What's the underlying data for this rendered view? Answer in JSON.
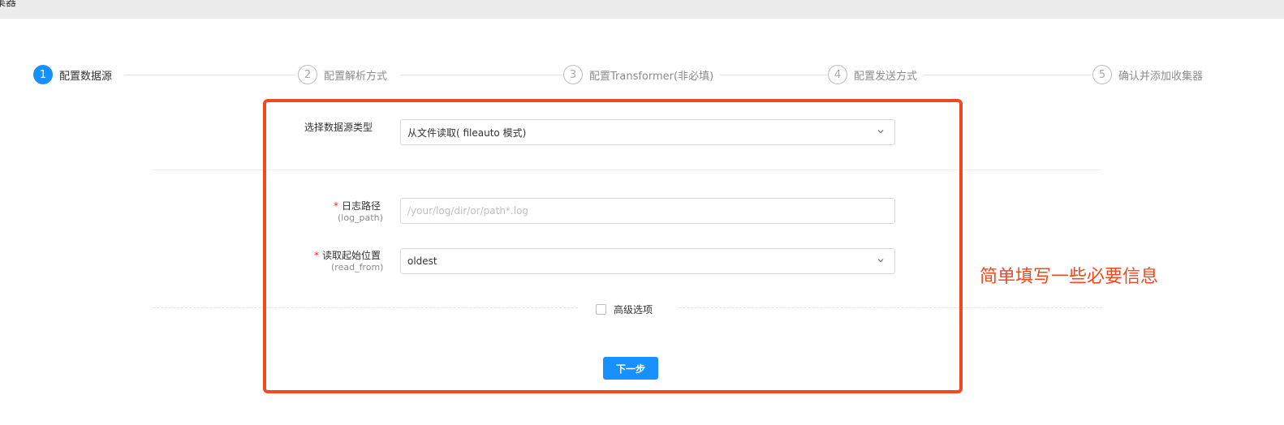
{
  "header": {
    "title": "集器"
  },
  "steps": [
    {
      "num": "1",
      "label": "配置数据源",
      "active": true
    },
    {
      "num": "2",
      "label": "配置解析方式",
      "active": false
    },
    {
      "num": "3",
      "label": "配置Transformer(非必填)",
      "active": false
    },
    {
      "num": "4",
      "label": "配置发送方式",
      "active": false
    },
    {
      "num": "5",
      "label": "确认并添加收集器",
      "active": false
    }
  ],
  "form": {
    "source_type": {
      "label": "选择数据源类型",
      "value": "从文件读取( fileauto 模式)"
    },
    "log_path": {
      "required": "*",
      "label": "日志路径",
      "sub": "(log_path)",
      "placeholder": "/your/log/dir/or/path*.log",
      "value": ""
    },
    "read_from": {
      "required": "*",
      "label": "读取起始位置",
      "sub": "(read_from)",
      "value": "oldest"
    },
    "advanced": {
      "label": "高级选项",
      "checked": false
    },
    "next_label": "下一步"
  },
  "annotation": {
    "note": "简单填写一些必要信息",
    "color": "#f2481e"
  },
  "colors": {
    "accent": "#1890ff",
    "required": "#f5222d"
  }
}
